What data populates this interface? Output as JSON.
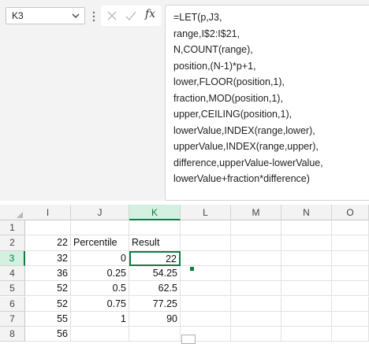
{
  "name_box": {
    "value": "K3"
  },
  "formula_bar": {
    "fx_label": "fx",
    "lines": [
      "=LET(p,J3,",
      "range,I$2:I$21,",
      "N,COUNT(range),",
      "position,(N-1)*p+1,",
      "lower,FLOOR(position,1),",
      "fraction,MOD(position,1),",
      "upper,CEILING(position,1),",
      "lowerValue,INDEX(range,lower),",
      "upperValue,INDEX(range,upper),",
      "difference,upperValue-lowerValue,",
      "lowerValue+fraction*difference)"
    ]
  },
  "columns": [
    "I",
    "J",
    "K",
    "L",
    "M",
    "N",
    "O"
  ],
  "active_column": "K",
  "rows": [
    {
      "num": "1",
      "I": "",
      "J": "",
      "K": ""
    },
    {
      "num": "2",
      "I": "22",
      "J": "Percentile",
      "K": "Result"
    },
    {
      "num": "3",
      "I": "32",
      "J": "0",
      "K": "22"
    },
    {
      "num": "4",
      "I": "36",
      "J": "0.25",
      "K": "54.25"
    },
    {
      "num": "5",
      "I": "52",
      "J": "0.5",
      "K": "62.5"
    },
    {
      "num": "6",
      "I": "52",
      "J": "0.75",
      "K": "77.25"
    },
    {
      "num": "7",
      "I": "55",
      "J": "1",
      "K": "90"
    },
    {
      "num": "8",
      "I": "56",
      "J": "",
      "K": ""
    }
  ],
  "active_row": "3",
  "accent_color": "#107c41"
}
